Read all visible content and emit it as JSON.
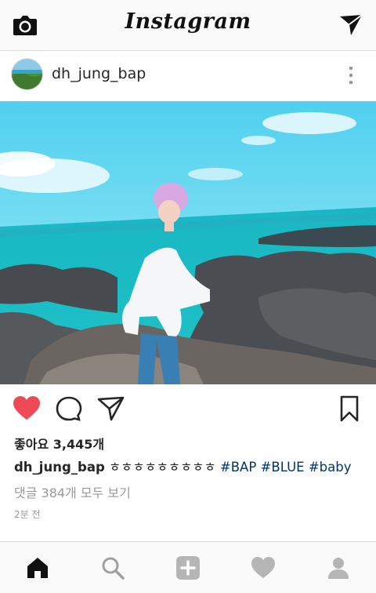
{
  "app": {
    "title": "Instagram"
  },
  "post": {
    "username": "dh_jung_bap",
    "likes": "좋아요 3,445개",
    "caption": {
      "username": "dh_jung_bap",
      "text": "ㅎㅎㅎㅎㅎㅎㅎㅎㅎ",
      "tags": [
        "#BAP",
        "#BLUE",
        "#baby"
      ]
    },
    "comments_link": "댓글 384개 모두 보기",
    "time": "2분 전",
    "liked": true
  },
  "icons": {
    "camera": "camera-icon",
    "direct": "direct-send-icon",
    "more": "more-vertical-icon",
    "like": "heart-filled-icon",
    "comment": "comment-icon",
    "share": "share-icon",
    "save": "bookmark-icon",
    "home": "home-icon",
    "search": "search-icon",
    "add": "add-icon",
    "activity": "heart-icon",
    "profile": "profile-icon"
  },
  "colors": {
    "like_red": "#ed4956",
    "hashtag": "#003569",
    "muted": "#999999"
  }
}
